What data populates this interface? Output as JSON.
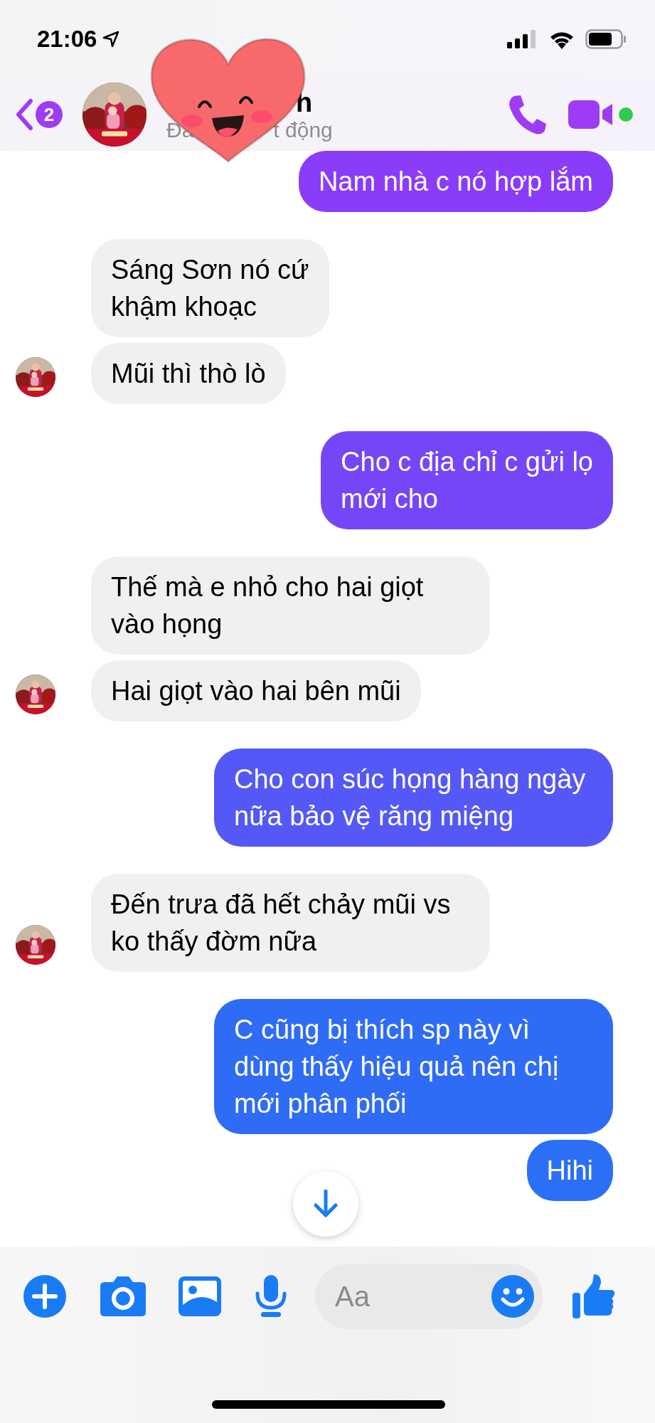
{
  "status_bar": {
    "time": "21:06"
  },
  "header": {
    "unread_count": "2",
    "name": "h",
    "status_parts": [
      "Đa",
      "t động"
    ]
  },
  "messages": [
    {
      "kind": "sent",
      "text": "Nam nhà c nó hợp lắm",
      "color": "#8a3cf8"
    },
    {
      "kind": "received",
      "text": "Sáng Sơn nó cứ\nkhậm khoạc",
      "show_avatar": false
    },
    {
      "kind": "received",
      "text": "Mũi thì thò lò",
      "show_avatar": true
    },
    {
      "kind": "sent",
      "text": "Cho c địa chỉ c gửi lọ\nmới cho",
      "color": "#7546f8"
    },
    {
      "kind": "received",
      "text": "Thế mà e nhỏ cho hai giọt vào họng",
      "show_avatar": false
    },
    {
      "kind": "received",
      "text": "Hai giọt vào hai bên mũi",
      "show_avatar": true
    },
    {
      "kind": "sent",
      "text": "Cho con súc họng hàng ngày nữa bảo vệ răng miệng",
      "color": "#5458f6"
    },
    {
      "kind": "received",
      "text": "Đến trưa đã hết chảy mũi vs ko thấy đờm nữa",
      "show_avatar": true
    },
    {
      "kind": "sent",
      "text": "C cũng bị thích sp này vì dùng thấy hiệu quả nên chị mới phân phối",
      "color": "#2f6cf6"
    },
    {
      "kind": "sent",
      "text": "Hihi",
      "color": "#2a6ff6"
    }
  ],
  "composer": {
    "placeholder": "Aa"
  }
}
